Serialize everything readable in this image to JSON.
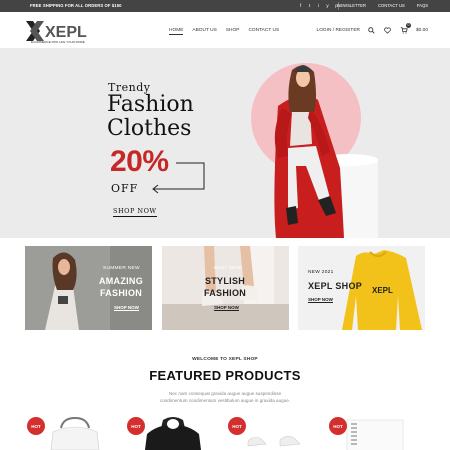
{
  "topbar": {
    "promo": "FREE SHIPPING FOR ALL ORDERS OF $150",
    "social": [
      "f",
      "t",
      "i",
      "y",
      "p"
    ],
    "links": [
      "NEWSLETTER",
      "CONTACT US",
      "FAQS"
    ]
  },
  "header": {
    "logo_text": "XEPL",
    "logo_tagline": "ECOMMERCE PRO LIFE YOUR PRIDE",
    "nav": [
      "HOME",
      "ABOUT US",
      "SHOP",
      "CONTACT US"
    ],
    "login": "LOGIN / REGISTER",
    "cart_count": "0",
    "cart_total": "$0.00"
  },
  "hero": {
    "eyebrow": "Trendy",
    "title_line1": "Fashion",
    "title_line2": "Clothes",
    "discount": "20%",
    "off": "OFF",
    "cta": "SHOP NOW"
  },
  "banners": [
    {
      "small": "SUMMER NEW",
      "big_line1": "AMAZING",
      "big_line2": "FASHION",
      "link": "SHOP NOW"
    },
    {
      "small": "BEST NEW",
      "big_line1": "STYLISH",
      "big_line2": "FASHION",
      "link": "SHOP NOW"
    },
    {
      "small": "NEW 2021",
      "big_line1": "XEPL SHOP",
      "link": "SHOP NOW",
      "sweater_logo": "XEPL"
    }
  ],
  "featured": {
    "welcome": "WELCOME TO XEPL SHOP",
    "title": "FEATURED PRODUCTS",
    "desc_line1": "Nec nam consequat gravida augue augue suspendisse",
    "desc_line2": "condimentum condimentum vestibulum augue in gravida augue."
  },
  "products": [
    {
      "badge": "HOT"
    },
    {
      "badge": "HOT"
    },
    {
      "badge": "HOT"
    },
    {
      "badge": "HOT"
    }
  ],
  "colors": {
    "topbar": "#444444",
    "accent_red": "#c62828",
    "hot_badge": "#d32f2f",
    "hero_bg": "#ebebeb",
    "coat_red": "#c81e1e",
    "sweater_yellow": "#f2c21b"
  }
}
